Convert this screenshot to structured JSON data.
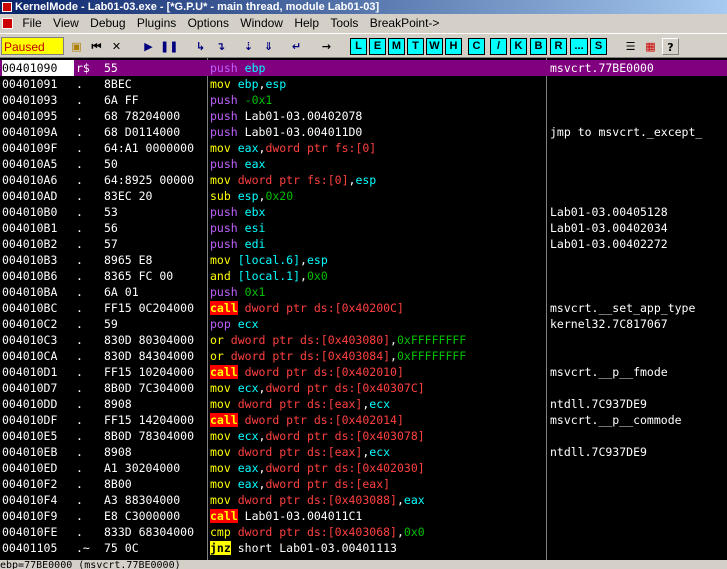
{
  "window": {
    "title": "KernelMode - Lab01-03.exe - [*G.P.U* - main thread, module Lab01-03]"
  },
  "menu": [
    "File",
    "View",
    "Debug",
    "Plugins",
    "Options",
    "Window",
    "Help",
    "Tools",
    "BreakPoint->"
  ],
  "toolbar": {
    "status": "Paused",
    "letters": [
      "L",
      "E",
      "M",
      "T",
      "W",
      "H",
      "C",
      "/",
      "K",
      "B",
      "R",
      "...",
      "S"
    ],
    "icons": [
      "open-icon",
      "restart-icon",
      "close-icon",
      "run-icon",
      "pause-icon",
      "step-into-icon",
      "step-over-icon",
      "trace-into-icon",
      "trace-over-icon",
      "execute-till-return-icon",
      "goto-icon",
      "list-icon",
      "palette-icon",
      "help-icon"
    ]
  },
  "colors": {
    "selected_row": "#800080",
    "push": "#c060ff",
    "mnemonic": "#ffff00",
    "register": "#00ffff",
    "memory": "#ff4040",
    "immediate": "#00c000",
    "call_bg": "#ff0000"
  },
  "rows": [
    {
      "addr": "00401090",
      "mark": "r$",
      "hex": "55",
      "op": "push",
      "opk": "push",
      "args": [
        [
          "ebp",
          "reg"
        ]
      ],
      "cmt": "msvcrt.77BE0000",
      "sel": true
    },
    {
      "addr": "00401091",
      "mark": ".",
      "hex": "8BEC",
      "op": "mov",
      "opk": "mov",
      "args": [
        [
          "ebp",
          "reg"
        ],
        [
          ",",
          "txt"
        ],
        [
          "esp",
          "reg"
        ]
      ],
      "cmt": ""
    },
    {
      "addr": "00401093",
      "mark": ".",
      "hex": "6A FF",
      "op": "push",
      "opk": "push",
      "args": [
        [
          "-0x1",
          "imm"
        ]
      ],
      "cmt": ""
    },
    {
      "addr": "00401095",
      "mark": ".",
      "hex": "68 78204000",
      "op": "push",
      "opk": "push",
      "args": [
        [
          "Lab01-03.00402078",
          "txt"
        ]
      ],
      "cmt": ""
    },
    {
      "addr": "0040109A",
      "mark": ".",
      "hex": "68 D0114000",
      "op": "push",
      "opk": "push",
      "args": [
        [
          "Lab01-03.004011D0",
          "txt"
        ]
      ],
      "cmt": "jmp to msvcrt._except_"
    },
    {
      "addr": "0040109F",
      "mark": ".",
      "hex": "64:A1 0000000",
      "op": "mov",
      "opk": "mov",
      "args": [
        [
          "eax",
          "reg"
        ],
        [
          ",",
          "txt"
        ],
        [
          "dword ptr fs:[0]",
          "mem"
        ]
      ],
      "cmt": ""
    },
    {
      "addr": "004010A5",
      "mark": ".",
      "hex": "50",
      "op": "push",
      "opk": "push",
      "args": [
        [
          "eax",
          "reg"
        ]
      ],
      "cmt": ""
    },
    {
      "addr": "004010A6",
      "mark": ".",
      "hex": "64:8925 00000",
      "op": "mov",
      "opk": "mov",
      "args": [
        [
          "dword ptr fs:[0]",
          "mem"
        ],
        [
          ",",
          "txt"
        ],
        [
          "esp",
          "reg"
        ]
      ],
      "cmt": ""
    },
    {
      "addr": "004010AD",
      "mark": ".",
      "hex": "83EC 20",
      "op": "sub",
      "opk": "sub",
      "args": [
        [
          "esp",
          "reg"
        ],
        [
          ",",
          "txt"
        ],
        [
          "0x20",
          "imm"
        ]
      ],
      "cmt": ""
    },
    {
      "addr": "004010B0",
      "mark": ".",
      "hex": "53",
      "op": "push",
      "opk": "push",
      "args": [
        [
          "ebx",
          "reg"
        ]
      ],
      "cmt": "Lab01-03.00405128"
    },
    {
      "addr": "004010B1",
      "mark": ".",
      "hex": "56",
      "op": "push",
      "opk": "push",
      "args": [
        [
          "esi",
          "reg"
        ]
      ],
      "cmt": "Lab01-03.00402034"
    },
    {
      "addr": "004010B2",
      "mark": ".",
      "hex": "57",
      "op": "push",
      "opk": "push",
      "args": [
        [
          "edi",
          "reg"
        ]
      ],
      "cmt": "Lab01-03.00402272"
    },
    {
      "addr": "004010B3",
      "mark": ".",
      "hex": "8965 E8",
      "op": "mov",
      "opk": "mov",
      "args": [
        [
          "[local.6]",
          "reg"
        ],
        [
          ",",
          "txt"
        ],
        [
          "esp",
          "reg"
        ]
      ],
      "cmt": ""
    },
    {
      "addr": "004010B6",
      "mark": ".",
      "hex": "8365 FC 00",
      "op": "and",
      "opk": "and",
      "args": [
        [
          "[local.1]",
          "reg"
        ],
        [
          ",",
          "txt"
        ],
        [
          "0x0",
          "imm"
        ]
      ],
      "cmt": ""
    },
    {
      "addr": "004010BA",
      "mark": ".",
      "hex": "6A 01",
      "op": "push",
      "opk": "push",
      "args": [
        [
          "0x1",
          "imm"
        ]
      ],
      "cmt": ""
    },
    {
      "addr": "004010BC",
      "mark": ".",
      "hex": "FF15 0C204000",
      "op": "call",
      "opk": "call",
      "args": [
        [
          "dword ptr ds:[0x40200C]",
          "mem"
        ]
      ],
      "cmt": "msvcrt.__set_app_type"
    },
    {
      "addr": "004010C2",
      "mark": ".",
      "hex": "59",
      "op": "pop",
      "opk": "push",
      "args": [
        [
          "ecx",
          "reg"
        ]
      ],
      "cmt": "kernel32.7C817067"
    },
    {
      "addr": "004010C3",
      "mark": ".",
      "hex": "830D 80304000",
      "op": "or",
      "opk": "or",
      "args": [
        [
          "dword ptr ds:[0x403080]",
          "mem"
        ],
        [
          ",",
          "txt"
        ],
        [
          "0xFFFFFFFF",
          "imm"
        ]
      ],
      "cmt": ""
    },
    {
      "addr": "004010CA",
      "mark": ".",
      "hex": "830D 84304000",
      "op": "or",
      "opk": "or",
      "args": [
        [
          "dword ptr ds:[0x403084]",
          "mem"
        ],
        [
          ",",
          "txt"
        ],
        [
          "0xFFFFFFFF",
          "imm"
        ]
      ],
      "cmt": ""
    },
    {
      "addr": "004010D1",
      "mark": ".",
      "hex": "FF15 10204000",
      "op": "call",
      "opk": "call",
      "args": [
        [
          "dword ptr ds:[0x402010]",
          "mem"
        ]
      ],
      "cmt": "msvcrt.__p__fmode"
    },
    {
      "addr": "004010D7",
      "mark": ".",
      "hex": "8B0D 7C304000",
      "op": "mov",
      "opk": "mov",
      "args": [
        [
          "ecx",
          "reg"
        ],
        [
          ",",
          "txt"
        ],
        [
          "dword ptr ds:[0x40307C]",
          "mem"
        ]
      ],
      "cmt": ""
    },
    {
      "addr": "004010DD",
      "mark": ".",
      "hex": "8908",
      "op": "mov",
      "opk": "mov",
      "args": [
        [
          "dword ptr ds:[eax]",
          "mem"
        ],
        [
          ",",
          "txt"
        ],
        [
          "ecx",
          "reg"
        ]
      ],
      "cmt": "ntdll.7C937DE9"
    },
    {
      "addr": "004010DF",
      "mark": ".",
      "hex": "FF15 14204000",
      "op": "call",
      "opk": "call",
      "args": [
        [
          "dword ptr ds:[0x402014]",
          "mem"
        ]
      ],
      "cmt": "msvcrt.__p__commode"
    },
    {
      "addr": "004010E5",
      "mark": ".",
      "hex": "8B0D 78304000",
      "op": "mov",
      "opk": "mov",
      "args": [
        [
          "ecx",
          "reg"
        ],
        [
          ",",
          "txt"
        ],
        [
          "dword ptr ds:[0x403078]",
          "mem"
        ]
      ],
      "cmt": ""
    },
    {
      "addr": "004010EB",
      "mark": ".",
      "hex": "8908",
      "op": "mov",
      "opk": "mov",
      "args": [
        [
          "dword ptr ds:[eax]",
          "mem"
        ],
        [
          ",",
          "txt"
        ],
        [
          "ecx",
          "reg"
        ]
      ],
      "cmt": "ntdll.7C937DE9"
    },
    {
      "addr": "004010ED",
      "mark": ".",
      "hex": "A1 30204000",
      "op": "mov",
      "opk": "mov",
      "args": [
        [
          "eax",
          "reg"
        ],
        [
          ",",
          "txt"
        ],
        [
          "dword ptr ds:[0x402030]",
          "mem"
        ]
      ],
      "cmt": ""
    },
    {
      "addr": "004010F2",
      "mark": ".",
      "hex": "8B00",
      "op": "mov",
      "opk": "mov",
      "args": [
        [
          "eax",
          "reg"
        ],
        [
          ",",
          "txt"
        ],
        [
          "dword ptr ds:[eax]",
          "mem"
        ]
      ],
      "cmt": ""
    },
    {
      "addr": "004010F4",
      "mark": ".",
      "hex": "A3 88304000",
      "op": "mov",
      "opk": "mov",
      "args": [
        [
          "dword ptr ds:[0x403088]",
          "mem"
        ],
        [
          ",",
          "txt"
        ],
        [
          "eax",
          "reg"
        ]
      ],
      "cmt": ""
    },
    {
      "addr": "004010F9",
      "mark": ".",
      "hex": "E8 C3000000",
      "op": "call",
      "opk": "call",
      "args": [
        [
          "Lab01-03.004011C1",
          "txt"
        ]
      ],
      "cmt": ""
    },
    {
      "addr": "004010FE",
      "mark": ".",
      "hex": "833D 68304000",
      "op": "cmp",
      "opk": "cmp",
      "args": [
        [
          "dword ptr ds:[0x403068]",
          "mem"
        ],
        [
          ",",
          "txt"
        ],
        [
          "0x0",
          "imm"
        ]
      ],
      "cmt": ""
    },
    {
      "addr": "00401105",
      "mark": ".~",
      "hex": "75 0C",
      "op": "jnz",
      "opk": "jnz",
      "args": [
        [
          "short Lab01-03.00401113",
          "txt"
        ]
      ],
      "cmt": ""
    }
  ],
  "footer": "ebp=77BE0000 (msvcrt.77BE0000)"
}
